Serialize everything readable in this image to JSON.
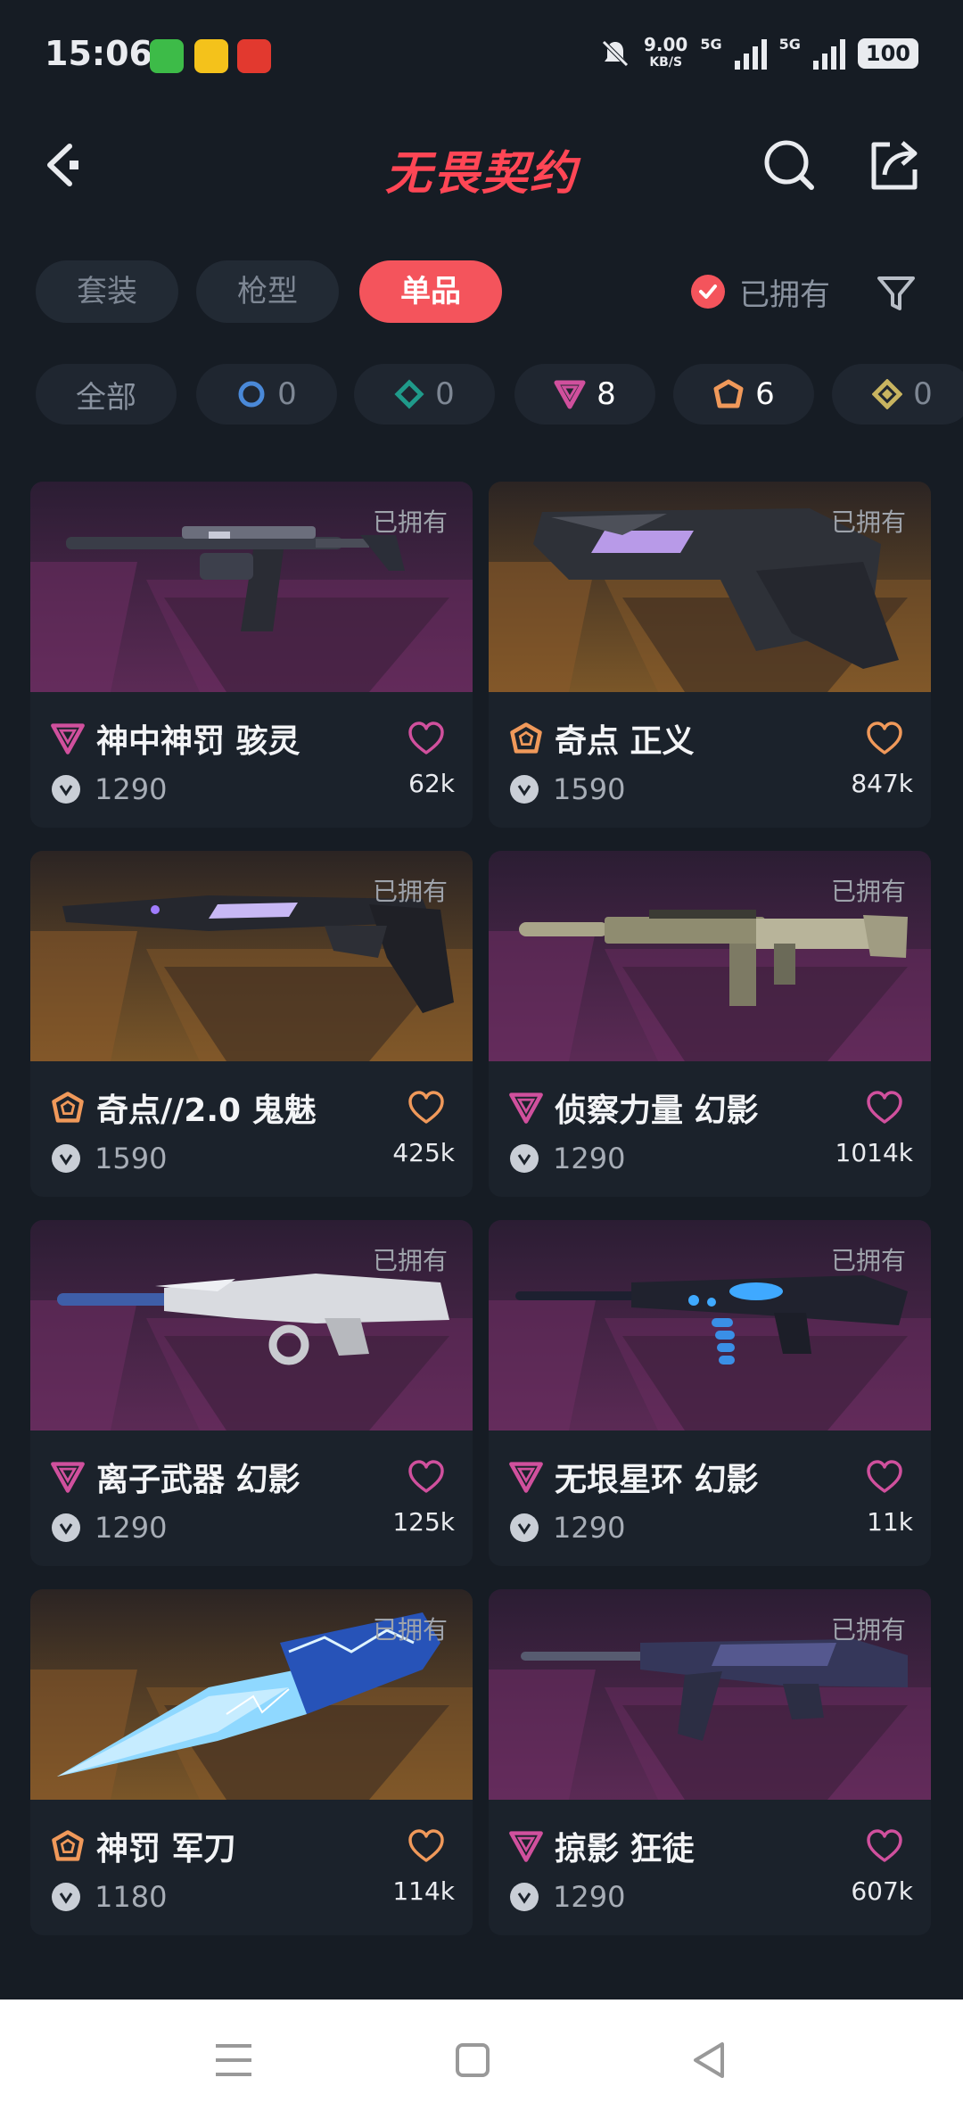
{
  "status_bar": {
    "time": "15:06",
    "net_speed": "9.00",
    "net_unit": "KB/S",
    "network_1": "5G",
    "network_2": "5G",
    "battery": "100"
  },
  "header": {
    "title": "无畏契约"
  },
  "tabs": [
    {
      "label": "套装",
      "active": false
    },
    {
      "label": "枪型",
      "active": false
    },
    {
      "label": "单品",
      "active": true
    }
  ],
  "owned_filter": {
    "label": "已拥有",
    "checked": true
  },
  "rarity_chips": [
    {
      "label": "全部",
      "icon": "all",
      "count": ""
    },
    {
      "label": "",
      "icon": "select-tier-icon",
      "color": "#4a89d8",
      "count": "0"
    },
    {
      "label": "",
      "icon": "deluxe-tier-icon",
      "color": "#1f9a8a",
      "count": "0"
    },
    {
      "label": "",
      "icon": "premium-tier-icon",
      "color": "#d0509d",
      "count": "8"
    },
    {
      "label": "",
      "icon": "exclusive-tier-icon",
      "color": "#f0995a",
      "count": "6"
    },
    {
      "label": "",
      "icon": "ultra-tier-icon",
      "color": "#c8b460",
      "count": "0"
    }
  ],
  "items": [
    {
      "name": "神中神罚 骇灵",
      "tier": "premium",
      "price": "1290",
      "likes": "62k",
      "owned": "已拥有",
      "bg": "purple",
      "weapon": "smg"
    },
    {
      "name": "奇点 正义",
      "tier": "exclusive",
      "price": "1590",
      "likes": "847k",
      "owned": "已拥有",
      "bg": "gold",
      "weapon": "revolver"
    },
    {
      "name": "奇点//2.0 鬼魅",
      "tier": "exclusive",
      "price": "1590",
      "likes": "425k",
      "owned": "已拥有",
      "bg": "gold",
      "weapon": "pistol"
    },
    {
      "name": "侦察力量 幻影",
      "tier": "premium",
      "price": "1290",
      "likes": "1014k",
      "owned": "已拥有",
      "bg": "purple",
      "weapon": "rifle-tan"
    },
    {
      "name": "离子武器 幻影",
      "tier": "premium",
      "price": "1290",
      "likes": "125k",
      "owned": "已拥有",
      "bg": "purple",
      "weapon": "rifle-white"
    },
    {
      "name": "无垠星环 幻影",
      "tier": "premium",
      "price": "1290",
      "likes": "11k",
      "owned": "已拥有",
      "bg": "purple",
      "weapon": "rifle-dark"
    },
    {
      "name": "神罚 军刀",
      "tier": "exclusive",
      "price": "1180",
      "likes": "114k",
      "owned": "已拥有",
      "bg": "gold",
      "weapon": "knife"
    },
    {
      "name": "掠影 狂徒",
      "tier": "premium",
      "price": "1290",
      "likes": "607k",
      "owned": "已拥有",
      "bg": "purple",
      "weapon": "rifle-purple"
    }
  ],
  "colors": {
    "accent": "#f4545c",
    "premium": "#d0509d",
    "exclusive": "#f0995a"
  }
}
